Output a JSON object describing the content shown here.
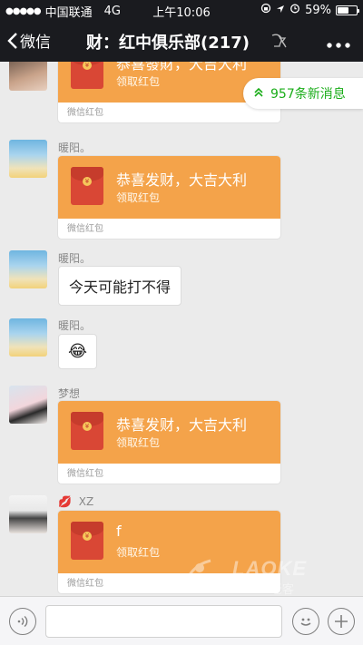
{
  "status_bar": {
    "signal_dots": "●●●●●",
    "carrier": "中国联通",
    "network": "4G",
    "time": "上午10:06",
    "battery": "59%",
    "battery_level": 0.59
  },
  "nav": {
    "back_label": "微信",
    "title": "财：红中俱乐部(217)"
  },
  "new_messages": {
    "label": "957条新消息"
  },
  "messages": [
    {
      "type": "red_packet",
      "sender": "",
      "title": "恭喜發財，大吉大利",
      "subtitle": "领取红包",
      "footer": "微信红包"
    },
    {
      "type": "red_packet",
      "sender": "暖阳。",
      "title": "恭喜发财，大吉大利",
      "subtitle": "领取红包",
      "footer": "微信红包"
    },
    {
      "type": "text",
      "sender": "暖阳。",
      "text": "今天可能打不得"
    },
    {
      "type": "emoji",
      "sender": "暖阳。",
      "text": "😂"
    },
    {
      "type": "red_packet",
      "sender": "梦想",
      "title": "恭喜发财，大吉大利",
      "subtitle": "领取红包",
      "footer": "微信红包"
    },
    {
      "type": "red_packet",
      "sender": "XZ",
      "sender_emoji": "💋",
      "title": "f",
      "subtitle": "领取红包",
      "footer": "微信红包"
    }
  ],
  "watermark": {
    "text": "LAOKE",
    "sub": ".com 老客"
  },
  "input_bar": {
    "value": "",
    "placeholder": ""
  },
  "colors": {
    "accent_green": "#1aad19",
    "red_packet_orange": "#f4a34a",
    "header_dark": "#1a1b1f",
    "chat_bg": "#ebebeb"
  }
}
